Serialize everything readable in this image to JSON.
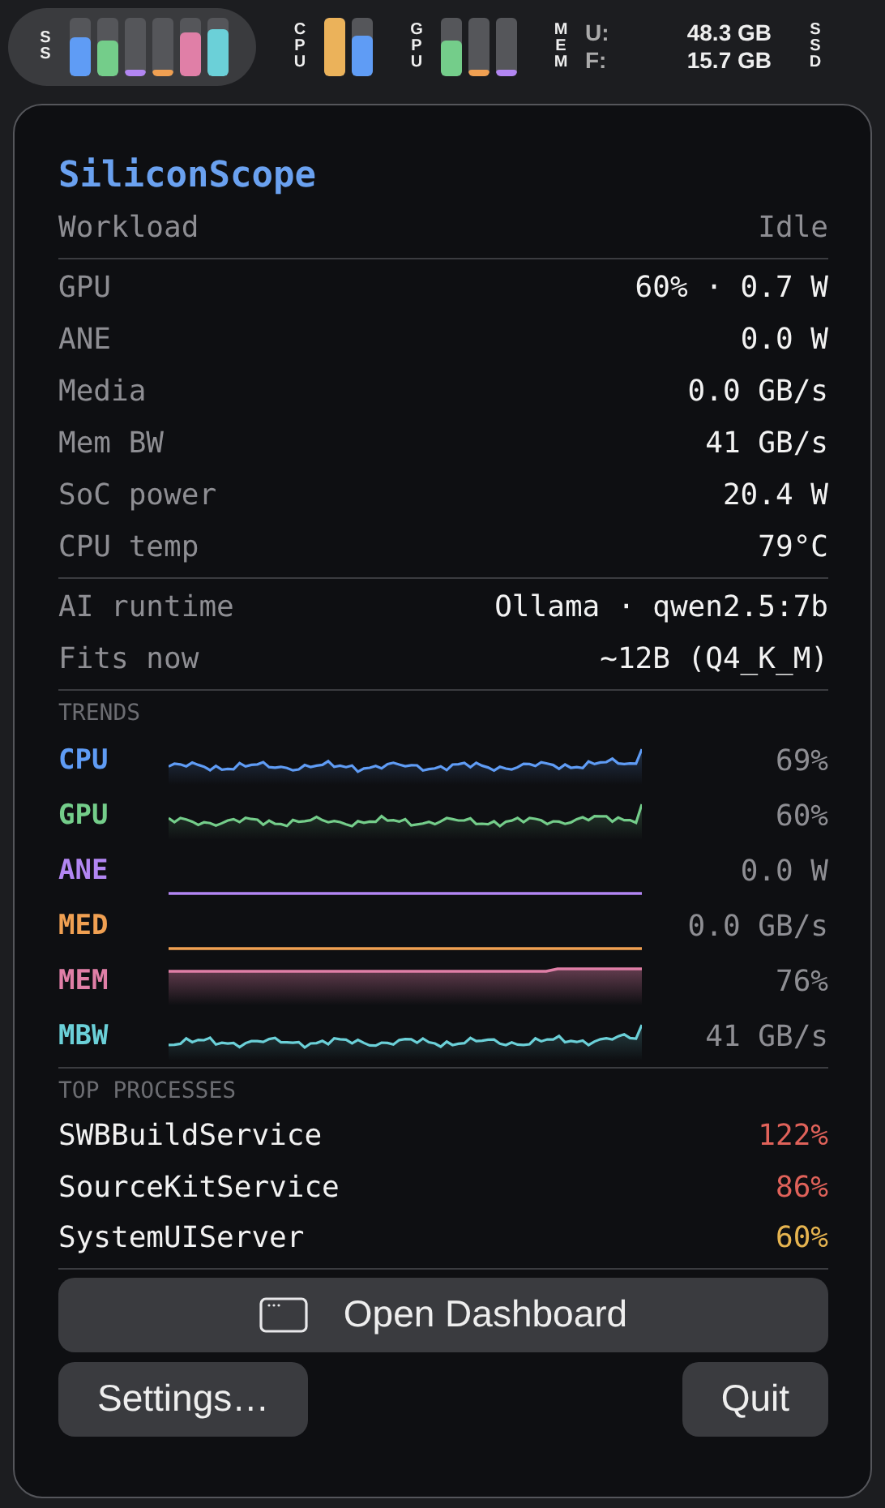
{
  "menubar": [
    {
      "kind": "bars",
      "label": "SS",
      "highlighted": true,
      "bars": [
        {
          "level": 0.68,
          "color": "#5f9cf5"
        },
        {
          "level": 0.6,
          "color": "#74cd8a"
        },
        {
          "level": 0.1,
          "color": "#b286f2"
        },
        {
          "level": 0.1,
          "color": "#f0a052"
        },
        {
          "level": 0.75,
          "color": "#e07fa7"
        },
        {
          "level": 0.8,
          "color": "#6bd0d8"
        }
      ]
    },
    {
      "kind": "bars",
      "label": "CPU",
      "highlighted": false,
      "bars": [
        {
          "level": 1.0,
          "color": "#ebb25a"
        },
        {
          "level": 0.7,
          "color": "#5f9cf5"
        }
      ]
    },
    {
      "kind": "bars",
      "label": "GPU",
      "highlighted": false,
      "bars": [
        {
          "level": 0.6,
          "color": "#74cd8a"
        },
        {
          "level": 0.1,
          "color": "#f0a052"
        },
        {
          "level": 0.1,
          "color": "#b286f2"
        }
      ]
    },
    {
      "kind": "memory",
      "label": "MEM",
      "lines": [
        {
          "key": "U:",
          "value": "48.3 GB"
        },
        {
          "key": "F:",
          "value": "15.7 GB"
        }
      ]
    },
    {
      "kind": "label",
      "label": "SSD"
    }
  ],
  "panel": {
    "title": "SiliconScope",
    "workload": {
      "label": "Workload",
      "value": "Idle"
    },
    "metrics": [
      {
        "label": "GPU",
        "value": "60% · 0.7 W"
      },
      {
        "label": "ANE",
        "value": "0.0 W"
      },
      {
        "label": "Media",
        "value": "0.0 GB/s"
      },
      {
        "label": "Mem BW",
        "value": "41 GB/s"
      },
      {
        "label": "SoC power",
        "value": "20.4 W"
      },
      {
        "label": "CPU temp",
        "value": "79°C"
      }
    ],
    "ai": [
      {
        "label": "AI runtime",
        "value": "Ollama · qwen2.5:7b"
      },
      {
        "label": "Fits now",
        "value": "~12B (Q4_K_M)"
      }
    ],
    "trends_heading": "TRENDS",
    "trends": [
      {
        "label": "CPU",
        "color": "#5f9cf5",
        "kind": "wave",
        "value": "69%"
      },
      {
        "label": "GPU",
        "color": "#74cd8a",
        "kind": "wave",
        "value": "60%"
      },
      {
        "label": "ANE",
        "color": "#b286f2",
        "kind": "flat",
        "value": "0.0 W"
      },
      {
        "label": "MED",
        "color": "#f0a052",
        "kind": "flat",
        "value": "0.0 GB/s"
      },
      {
        "label": "MEM",
        "color": "#e07fa7",
        "kind": "fill",
        "value": "76%"
      },
      {
        "label": "MBW",
        "color": "#6bd0d8",
        "kind": "wave",
        "value": "41 GB/s"
      }
    ],
    "processes_heading": "TOP PROCESSES",
    "processes": [
      {
        "name": "SWBBuildService",
        "value": "122%",
        "color": "#e0625a"
      },
      {
        "name": "SourceKitService",
        "value": "86%",
        "color": "#e0625a"
      },
      {
        "name": "SystemUIServer",
        "value": "60%",
        "color": "#e6b450"
      }
    ],
    "dashboard_button": "Open Dashboard",
    "settings_button": "Settings…",
    "quit_button": "Quit"
  }
}
